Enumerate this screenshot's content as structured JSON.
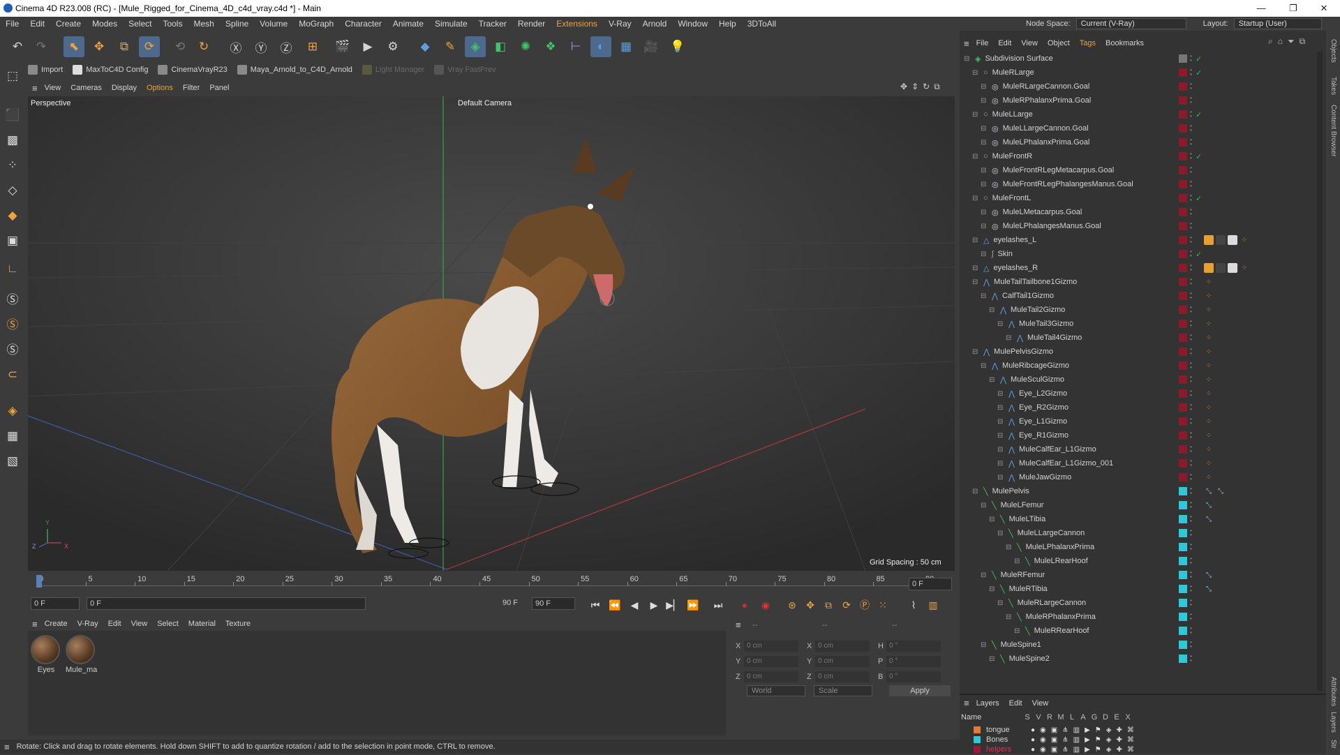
{
  "window": {
    "title": "Cinema 4D R23.008 (RC) - [Mule_Rigged_for_Cinema_4D_c4d_vray.c4d *] - Main",
    "min": "—",
    "max": "❐",
    "close": "✕"
  },
  "menubar": [
    "File",
    "Edit",
    "Create",
    "Modes",
    "Select",
    "Tools",
    "Mesh",
    "Spline",
    "Volume",
    "MoGraph",
    "Character",
    "Animate",
    "Simulate",
    "Tracker",
    "Render",
    "Extensions",
    "V-Ray",
    "Arnold",
    "Window",
    "Help",
    "3DToAll"
  ],
  "topright": {
    "node_space_label": "Node Space:",
    "node_space_value": "Current (V-Ray)",
    "layout_label": "Layout:",
    "layout_value": "Startup (User)"
  },
  "pluginbar": {
    "items": [
      "Import",
      "MaxToC4D Config",
      "CinemaVrayR23",
      "Maya_Arnold_to_C4D_Arnold",
      "Light Manager",
      "Vray FastPrev"
    ]
  },
  "viewport": {
    "menu": [
      "View",
      "Cameras",
      "Display",
      "Options",
      "Filter",
      "Panel"
    ],
    "view_name": "Perspective",
    "camera": "Default Camera",
    "grid_spacing": "Grid Spacing : 50 cm",
    "axis_y": "Y",
    "axis_z": "Z",
    "axis_x": "X"
  },
  "timeline": {
    "ticks": [
      "0",
      "5",
      "10",
      "15",
      "20",
      "25",
      "30",
      "35",
      "40",
      "45",
      "50",
      "55",
      "60",
      "65",
      "70",
      "75",
      "80",
      "85",
      "90"
    ],
    "current_frame": "0 F",
    "start_field": "0 F",
    "range_start": "0 F",
    "range_end": "90 F",
    "end_field": "90 F"
  },
  "materials": {
    "menu": [
      "Create",
      "V-Ray",
      "Edit",
      "View",
      "Select",
      "Material",
      "Texture"
    ],
    "items": [
      "Eyes",
      "Mule_ma"
    ]
  },
  "coords": {
    "header_left": "--",
    "header_mid": "--",
    "header_right": "--",
    "rows": [
      {
        "a": "X",
        "av": "0 cm",
        "b": "X",
        "bv": "0 cm",
        "c": "H",
        "cv": "0 °"
      },
      {
        "a": "Y",
        "av": "0 cm",
        "b": "Y",
        "bv": "0 cm",
        "c": "P",
        "cv": "0 °"
      },
      {
        "a": "Z",
        "av": "0 cm",
        "b": "Z",
        "bv": "0 cm",
        "c": "B",
        "cv": "0 °"
      }
    ],
    "world": "World",
    "scale": "Scale",
    "apply": "Apply"
  },
  "status": "Rotate: Click and drag to rotate elements. Hold down SHIFT to add to quantize rotation / add to the selection in point mode, CTRL to remove.",
  "objects": {
    "menu": [
      "File",
      "Edit",
      "View",
      "Object",
      "Tags",
      "Bookmarks"
    ],
    "rows": [
      {
        "name": "Subdivision Surface",
        "indent": 0,
        "icon": "subdivision-icon",
        "color": "#777777",
        "check": "✓"
      },
      {
        "name": "MuleRLarge",
        "indent": 1,
        "icon": "null-icon",
        "color": "#8b1a2a",
        "check": "✓"
      },
      {
        "name": "MuleRLargeCannon.Goal",
        "indent": 2,
        "icon": "goal-icon",
        "color": "#8b1a2a",
        "check": ""
      },
      {
        "name": "MuleRPhalanxPrima.Goal",
        "indent": 2,
        "icon": "goal-icon",
        "color": "#8b1a2a",
        "check": ""
      },
      {
        "name": "MuleLLarge",
        "indent": 1,
        "icon": "null-icon",
        "color": "#8b1a2a",
        "check": "✓"
      },
      {
        "name": "MuleLLargeCannon.Goal",
        "indent": 2,
        "icon": "goal-icon",
        "color": "#8b1a2a",
        "check": ""
      },
      {
        "name": "MuleLPhalanxPrima.Goal",
        "indent": 2,
        "icon": "goal-icon",
        "color": "#8b1a2a",
        "check": ""
      },
      {
        "name": "MuleFrontR",
        "indent": 1,
        "icon": "null-icon",
        "color": "#8b1a2a",
        "check": "✓"
      },
      {
        "name": "MuleFrontRLegMetacarpus.Goal",
        "indent": 2,
        "icon": "goal-icon",
        "color": "#8b1a2a",
        "check": ""
      },
      {
        "name": "MuleFrontRLegPhalangesManus.Goal",
        "indent": 2,
        "icon": "goal-icon",
        "color": "#8b1a2a",
        "check": ""
      },
      {
        "name": "MuleFrontL",
        "indent": 1,
        "icon": "null-icon",
        "color": "#8b1a2a",
        "check": "✓"
      },
      {
        "name": "MuleLMetacarpus.Goal",
        "indent": 2,
        "icon": "goal-icon",
        "color": "#8b1a2a",
        "check": ""
      },
      {
        "name": "MuleLPhalangesManus.Goal",
        "indent": 2,
        "icon": "goal-icon",
        "color": "#8b1a2a",
        "check": ""
      },
      {
        "name": "eyelashes_L",
        "indent": 1,
        "icon": "mesh-icon",
        "color": "#8b1a2a",
        "check": "",
        "tags": "mat"
      },
      {
        "name": "Skin",
        "indent": 2,
        "icon": "skin-icon",
        "color": "#8b1a2a",
        "check": "✓"
      },
      {
        "name": "eyelashes_R",
        "indent": 1,
        "icon": "mesh-icon",
        "color": "#8b1a2a",
        "check": "",
        "tags": "mat"
      },
      {
        "name": "MuleTailTailbone1Gizmo",
        "indent": 1,
        "icon": "joint-icon",
        "color": "#8b1a2a",
        "check": "",
        "tags": "dot"
      },
      {
        "name": "CalfTail1Gizmo",
        "indent": 2,
        "icon": "joint-icon",
        "color": "#8b1a2a",
        "check": "",
        "tags": "dot"
      },
      {
        "name": "MuleTail2Gizmo",
        "indent": 3,
        "icon": "joint-icon",
        "color": "#8b1a2a",
        "check": "",
        "tags": "dot"
      },
      {
        "name": "MuleTail3Gizmo",
        "indent": 4,
        "icon": "joint-icon",
        "color": "#8b1a2a",
        "check": "",
        "tags": "dot"
      },
      {
        "name": "MuleTail4Gizmo",
        "indent": 5,
        "icon": "joint-icon",
        "color": "#8b1a2a",
        "check": "",
        "tags": "dot"
      },
      {
        "name": "MulePelvisGizmo",
        "indent": 1,
        "icon": "joint-icon",
        "color": "#8b1a2a",
        "check": "",
        "tags": "dot"
      },
      {
        "name": "MuleRibcageGizmo",
        "indent": 2,
        "icon": "joint-icon",
        "color": "#8b1a2a",
        "check": "",
        "tags": "dot"
      },
      {
        "name": "MuleSculGizmo",
        "indent": 3,
        "icon": "joint-icon",
        "color": "#8b1a2a",
        "check": "",
        "tags": "dot"
      },
      {
        "name": "Eye_L2Gizmo",
        "indent": 4,
        "icon": "joint-icon",
        "color": "#8b1a2a",
        "check": "",
        "tags": "dot"
      },
      {
        "name": "Eye_R2Gizmo",
        "indent": 4,
        "icon": "joint-icon",
        "color": "#8b1a2a",
        "check": "",
        "tags": "dot"
      },
      {
        "name": "Eye_L1Gizmo",
        "indent": 4,
        "icon": "joint-icon",
        "color": "#8b1a2a",
        "check": "",
        "tags": "dot"
      },
      {
        "name": "Eye_R1Gizmo",
        "indent": 4,
        "icon": "joint-icon",
        "color": "#8b1a2a",
        "check": "",
        "tags": "dot"
      },
      {
        "name": "MuleCalfEar_L1Gizmo",
        "indent": 4,
        "icon": "joint-icon",
        "color": "#8b1a2a",
        "check": "",
        "tags": "dot"
      },
      {
        "name": "MuleCalfEar_L1Gizmo_001",
        "indent": 4,
        "icon": "joint-icon",
        "color": "#8b1a2a",
        "check": "",
        "tags": "dot"
      },
      {
        "name": "MuleJawGizmo",
        "indent": 4,
        "icon": "joint-icon",
        "color": "#8b1a2a",
        "check": "",
        "tags": "dot"
      },
      {
        "name": "MulePelvis",
        "indent": 1,
        "icon": "bone-icon",
        "color": "#2ec8d8",
        "check": "",
        "tags": "ik2"
      },
      {
        "name": "MuleLFemur",
        "indent": 2,
        "icon": "bone-icon",
        "color": "#2ec8d8",
        "check": "",
        "tags": "ik"
      },
      {
        "name": "MuleLTibia",
        "indent": 3,
        "icon": "bone-icon",
        "color": "#2ec8d8",
        "check": "",
        "tags": "ik"
      },
      {
        "name": "MuleLLargeCannon",
        "indent": 4,
        "icon": "bone-icon",
        "color": "#2ec8d8",
        "check": ""
      },
      {
        "name": "MuleLPhalanxPrima",
        "indent": 5,
        "icon": "bone-icon",
        "color": "#2ec8d8",
        "check": ""
      },
      {
        "name": "MuleLRearHoof",
        "indent": 6,
        "icon": "bone-icon",
        "color": "#2ec8d8",
        "check": ""
      },
      {
        "name": "MuleRFemur",
        "indent": 2,
        "icon": "bone-icon",
        "color": "#2ec8d8",
        "check": "",
        "tags": "ik"
      },
      {
        "name": "MuleRTibia",
        "indent": 3,
        "icon": "bone-icon",
        "color": "#2ec8d8",
        "check": "",
        "tags": "ik"
      },
      {
        "name": "MuleRLargeCannon",
        "indent": 4,
        "icon": "bone-icon",
        "color": "#2ec8d8",
        "check": ""
      },
      {
        "name": "MuleRPhalanxPrima",
        "indent": 5,
        "icon": "bone-icon",
        "color": "#2ec8d8",
        "check": ""
      },
      {
        "name": "MuleRRearHoof",
        "indent": 6,
        "icon": "bone-icon",
        "color": "#2ec8d8",
        "check": ""
      },
      {
        "name": "MuleSpine1",
        "indent": 2,
        "icon": "bone-icon",
        "color": "#2ec8d8",
        "check": ""
      },
      {
        "name": "MuleSpine2",
        "indent": 3,
        "icon": "bone-icon",
        "color": "#2ec8d8",
        "check": ""
      }
    ]
  },
  "layers": {
    "menu": [
      "Layers",
      "Edit",
      "View"
    ],
    "header_name": "Name",
    "header_cols": [
      "S",
      "V",
      "R",
      "M",
      "L",
      "A",
      "G",
      "D",
      "E",
      "X"
    ],
    "items": [
      {
        "name": "tongue",
        "color": "#e07b39"
      },
      {
        "name": "Bones",
        "color": "#2ec8d8"
      },
      {
        "name": "helpers",
        "color": "#a0183a"
      }
    ]
  },
  "sidetabs": [
    "Objects",
    "Takes",
    "Content Browser",
    "Attributes",
    "Layers",
    "Str"
  ]
}
